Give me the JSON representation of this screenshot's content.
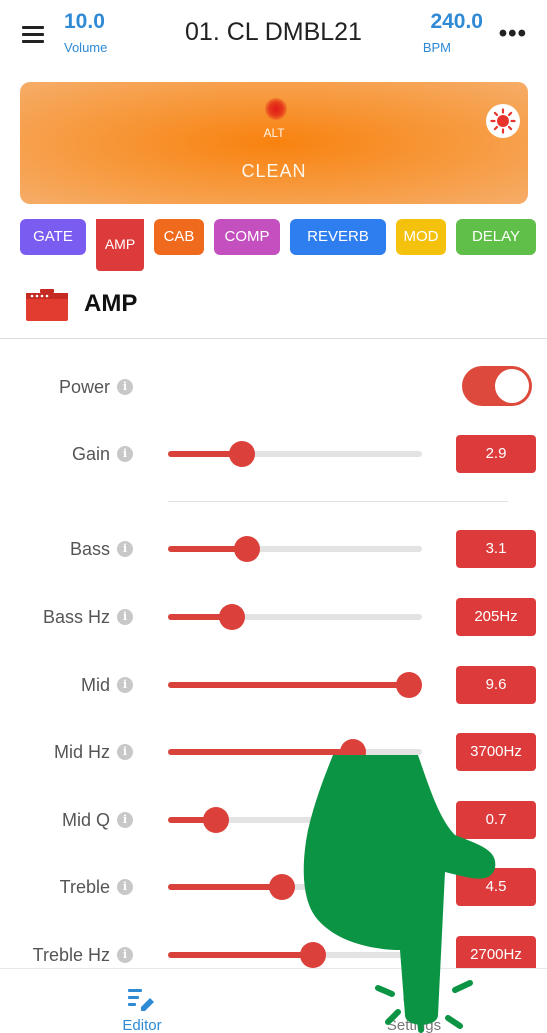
{
  "header": {
    "volume_value": "10.0",
    "volume_label": "Volume",
    "preset_title": "01. CL DMBL21",
    "bpm_value": "240.0",
    "bpm_label": "BPM",
    "menu_icon": "hamburger-menu-icon",
    "more_icon": "more-horizontal-icon"
  },
  "banner": {
    "alt_label": "ALT",
    "mode_label": "CLEAN",
    "indicator_icon": "red-dot-icon",
    "sun_icon": "sun-icon"
  },
  "tabs": [
    {
      "label": "GATE",
      "color": "#7b5cf0",
      "selected": false
    },
    {
      "label": "AMP",
      "color": "#dd3b3b",
      "selected": true
    },
    {
      "label": "CAB",
      "color": "#f06a1d",
      "selected": false
    },
    {
      "label": "COMP",
      "color": "#c44fbe",
      "selected": false
    },
    {
      "label": "REVERB",
      "color": "#2f7ef0",
      "selected": false
    },
    {
      "label": "MOD",
      "color": "#f4c20d",
      "selected": false
    },
    {
      "label": "DELAY",
      "color": "#5fbf48",
      "selected": false
    }
  ],
  "section": {
    "title": "AMP",
    "icon": "amplifier-icon"
  },
  "params": {
    "power": {
      "label": "Power",
      "on": true
    },
    "gain": {
      "label": "Gain",
      "value": "2.9",
      "fraction": 0.29
    },
    "bass": {
      "label": "Bass",
      "value": "3.1",
      "fraction": 0.31
    },
    "bass_hz": {
      "label": "Bass Hz",
      "value": "205Hz",
      "fraction": 0.25
    },
    "mid": {
      "label": "Mid",
      "value": "9.6",
      "fraction": 0.95
    },
    "mid_hz": {
      "label": "Mid Hz",
      "value": "3700Hz",
      "fraction": 0.73
    },
    "mid_q": {
      "label": "Mid Q",
      "value": "0.7",
      "fraction": 0.19
    },
    "treble": {
      "label": "Treble",
      "value": "4.5",
      "fraction": 0.45
    },
    "treble_hz": {
      "label": "Treble Hz",
      "value": "2700Hz",
      "fraction": 0.57
    }
  },
  "bottom_nav": {
    "editor_label": "Editor",
    "settings_label": "Settings",
    "active_color": "#2f8ad6"
  },
  "colors": {
    "accent_blue": "#2f8ad6",
    "slider_red": "#d9423b",
    "banner_orange": "#f8820f"
  }
}
